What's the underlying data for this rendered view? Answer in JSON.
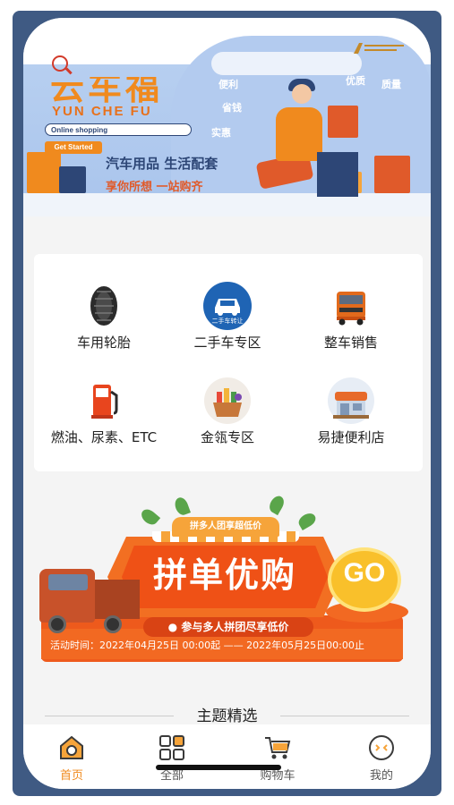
{
  "banner": {
    "brand_en": "YUN CHE FU",
    "online_shopping": "Online shopping",
    "get_started": "Get Started",
    "slogan_line1": "汽车用品 生活配套",
    "slogan_line2": "享你所想 一站购齐",
    "deco_words": [
      "便利",
      "省钱",
      "质量",
      "实惠",
      "优质"
    ]
  },
  "categories": [
    {
      "label": "车用轮胎",
      "icon": "tire-icon"
    },
    {
      "label": "二手车专区",
      "icon": "used-car-icon",
      "icon_text": "二手车转让"
    },
    {
      "label": "整车销售",
      "icon": "truck-icon"
    },
    {
      "label": "燃油、尿素、ETC",
      "icon": "fuel-pump-icon"
    },
    {
      "label": "金瓴专区",
      "icon": "shopping-basket-icon"
    },
    {
      "label": "易捷便利店",
      "icon": "convenience-store-icon"
    }
  ],
  "promo": {
    "top_tag": "拼多人团享超低价",
    "title": "拼单优购",
    "subtitle": "参与多人拼团尽享低价",
    "go": "GO",
    "time_text": "活动时间：2022年04月25日 00:00起 —— 2022年05月25日00:00止"
  },
  "theme": {
    "title": "主题精选"
  },
  "tabbar": {
    "items": [
      {
        "label": "首页",
        "icon": "home-icon",
        "active": true
      },
      {
        "label": "全部",
        "icon": "grid-icon",
        "active": false
      },
      {
        "label": "购物车",
        "icon": "cart-icon",
        "active": false
      },
      {
        "label": "我的",
        "icon": "profile-icon",
        "active": false
      }
    ]
  },
  "colors": {
    "accent": "#f08a1e",
    "frame": "#3f5a83",
    "promo_orange": "#f26922"
  }
}
